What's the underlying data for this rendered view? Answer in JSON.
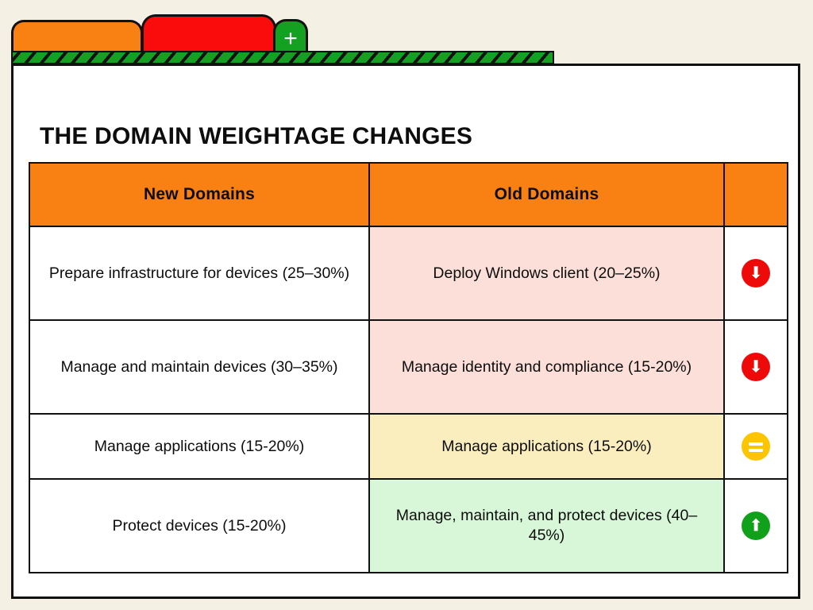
{
  "browser": {
    "tabs": [
      {
        "name": "tab-orange",
        "color": "#f98012",
        "label": ""
      },
      {
        "name": "tab-red",
        "color": "#fb0c0c",
        "label": ""
      }
    ],
    "new_tab_button": {
      "icon": "plus-icon",
      "label": "+",
      "color": "#14a020"
    },
    "hazard_bar_color": "#14a020"
  },
  "page": {
    "title": "THE DOMAIN WEIGHTAGE CHANGES",
    "background": "#f5f0e4",
    "card_background": "#ffffff"
  },
  "table": {
    "headers": [
      "New Domains",
      "Old Domains",
      ""
    ],
    "header_background": "#f98012",
    "rows": [
      {
        "new_domain": "Prepare infrastructure for devices (25–30%)",
        "old_domain": "Deploy Windows client (20–25%)",
        "old_cell_color": "#fbdfd8",
        "indicator": "arrow-down-icon",
        "indicator_glyph": "⬇",
        "indicator_color": "#ef0a0a"
      },
      {
        "new_domain": "Manage and maintain devices (30–35%)",
        "old_domain": "Manage identity and compliance (15-20%)",
        "old_cell_color": "#fbdfd8",
        "indicator": "arrow-down-icon",
        "indicator_glyph": "⬇",
        "indicator_color": "#ef0a0a"
      },
      {
        "new_domain": "Manage applications (15-20%)",
        "old_domain": "Manage applications (15-20%)",
        "old_cell_color": "#faeebf",
        "indicator": "equals-icon",
        "indicator_glyph": "=",
        "indicator_color": "#fdc400"
      },
      {
        "new_domain": "Protect devices (15-20%)",
        "old_domain": "Manage, maintain, and protect devices (40–45%)",
        "old_cell_color": "#d8f7d8",
        "indicator": "arrow-up-icon",
        "indicator_glyph": "⬆",
        "indicator_color": "#11a01a"
      }
    ]
  }
}
